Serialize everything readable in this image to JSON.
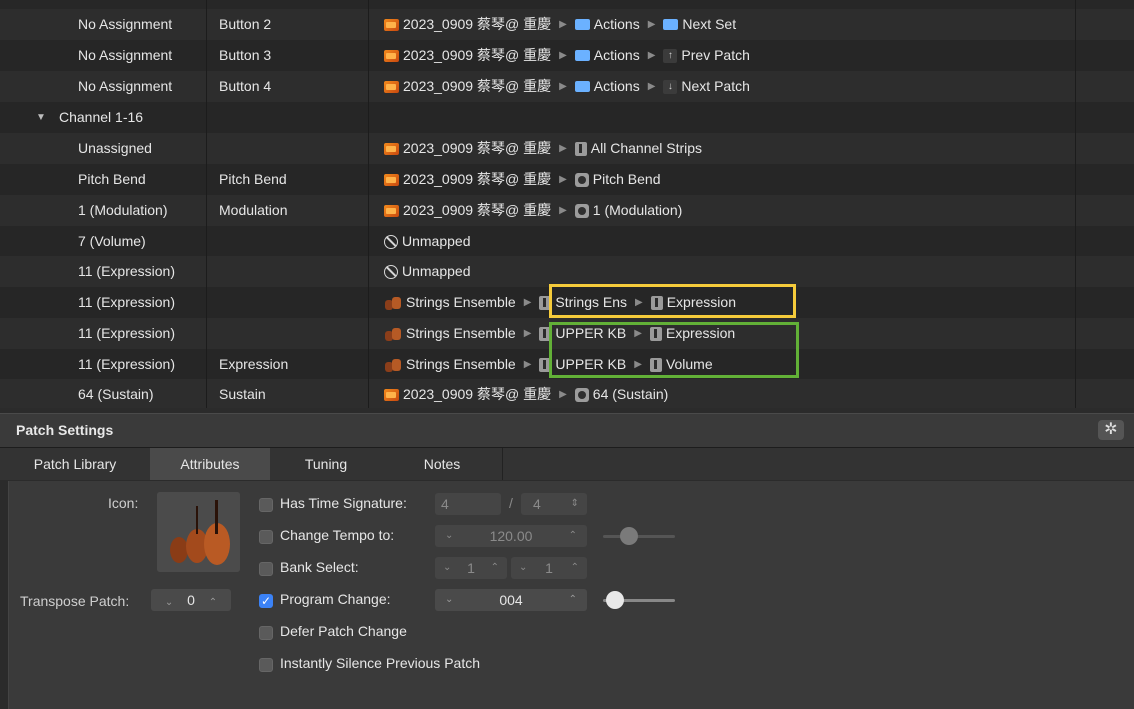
{
  "rows": [
    {
      "c1": "No Assignment",
      "c2": "Button 2",
      "path": {
        "project": "2023_0909 蔡琴@ 重慶",
        "folder": "Actions",
        "target": "Next Set"
      }
    },
    {
      "c1": "No Assignment",
      "c2": "Button 3",
      "path": {
        "project": "2023_0909 蔡琴@ 重慶",
        "folder": "Actions",
        "target": "Prev Patch"
      }
    },
    {
      "c1": "No Assignment",
      "c2": "Button 4",
      "path": {
        "project": "2023_0909 蔡琴@ 重慶",
        "folder": "Actions",
        "target": "Next Patch"
      }
    },
    {
      "group": "Channel 1-16"
    },
    {
      "c1": "Unassigned",
      "c2": "",
      "path": {
        "project": "2023_0909 蔡琴@ 重慶",
        "target": "All Channel Strips"
      }
    },
    {
      "c1": "Pitch Bend",
      "c2": "Pitch Bend",
      "path": {
        "project": "2023_0909 蔡琴@ 重慶",
        "target": "Pitch Bend"
      }
    },
    {
      "c1": "1 (Modulation)",
      "c2": "Modulation",
      "path": {
        "project": "2023_0909 蔡琴@ 重慶",
        "target": "1 (Modulation)"
      }
    },
    {
      "c1": "7 (Volume)",
      "c2": "",
      "unmapped": "Unmapped"
    },
    {
      "c1": "11 (Expression)",
      "c2": "",
      "unmapped": "Unmapped"
    },
    {
      "c1": "11 (Expression)",
      "c2": "",
      "path": {
        "project": "Strings Ensemble",
        "strip": "Strings Ens",
        "target": "Expression"
      }
    },
    {
      "c1": "11 (Expression)",
      "c2": "",
      "path": {
        "project": "Strings Ensemble",
        "strip": "UPPER KB",
        "target": "Expression"
      }
    },
    {
      "c1": "11 (Expression)",
      "c2": "Expression",
      "path": {
        "project": "Strings Ensemble",
        "strip": "UPPER KB",
        "target": "Volume"
      }
    },
    {
      "c1": "64 (Sustain)",
      "c2": "Sustain",
      "path": {
        "project": "2023_0909 蔡琴@ 重慶",
        "target": "64 (Sustain)"
      }
    }
  ],
  "patch_settings": {
    "title": "Patch Settings",
    "tabs": [
      "Patch Library",
      "Attributes",
      "Tuning",
      "Notes"
    ],
    "active_tab": "Attributes",
    "icon_label": "Icon:",
    "transpose_label": "Transpose Patch:",
    "transpose_value": "0",
    "time_sig": {
      "label": "Has Time Signature:",
      "checked": false,
      "num": "4",
      "slash": "/",
      "den": "4"
    },
    "tempo": {
      "label": "Change Tempo to:",
      "checked": false,
      "value": "120.00"
    },
    "bank": {
      "label": "Bank Select:",
      "checked": false,
      "msb": "1",
      "lsb": "1"
    },
    "program": {
      "label": "Program Change:",
      "checked": true,
      "value": "004"
    },
    "defer": {
      "label": "Defer Patch Change",
      "checked": false
    },
    "silence": {
      "label": "Instantly Silence Previous Patch",
      "checked": false
    }
  },
  "icons": {
    "project": "project-folder-icon",
    "actions": "blue-folder-icon",
    "strip": "channel-strip-icon",
    "knob": "knob-icon",
    "unmapped": "no-entry-icon",
    "gear": "gear-icon"
  },
  "colors": {
    "highlight_yellow": "#f5cb3b",
    "highlight_green": "#62b037",
    "accent_blue": "#3b82f6"
  }
}
